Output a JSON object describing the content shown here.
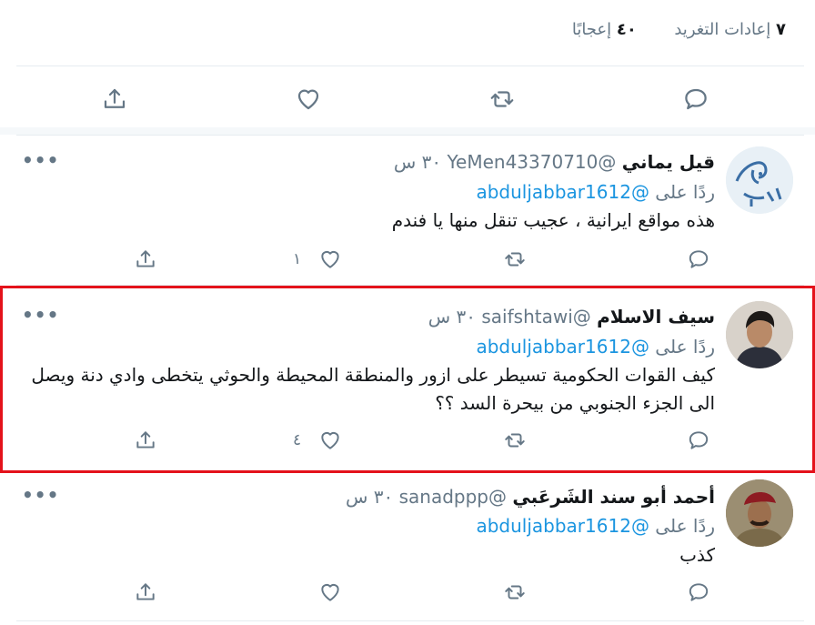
{
  "stats": {
    "retweets_count": "٧",
    "retweets_label": "إعادات التغريد",
    "likes_count": "٤٠",
    "likes_label": "إعجابًا"
  },
  "main_actions": {
    "reply_icon": "reply-icon",
    "retweet_icon": "retweet-icon",
    "like_icon": "heart-icon",
    "share_icon": "share-icon"
  },
  "replies": [
    {
      "name": "قيل يماني",
      "handle": "@YeMen43370710",
      "time": "٣٠ س",
      "replying_prefix": "ردًا على",
      "replying_to": "@abduljabbar1612",
      "text": "هذه مواقع ايرانية ، عجيب تنقل منها يا فندم",
      "like_count": "١",
      "more": "•••"
    },
    {
      "name": "سيف الاسلام",
      "handle": "@saifshtawi",
      "time": "٣٠ س",
      "replying_prefix": "ردًا على",
      "replying_to": "@abduljabbar1612",
      "text": "كيف القوات الحكومية تسيطر على ازور والمنطقة المحيطة والحوثي يتخطى وادي دنة ويصل الى الجزء الجنوبي من بيحرة السد ؟؟",
      "like_count": "٤",
      "more": "•••"
    },
    {
      "name": "أحمد أبو سند الشَرعَبي",
      "handle": "@sanadppp",
      "time": "٣٠ س",
      "replying_prefix": "ردًا على",
      "replying_to": "@abduljabbar1612",
      "text": "كذب",
      "like_count": "",
      "more": "•••"
    }
  ],
  "colors": {
    "link": "#1b95e0",
    "muted": "#657786",
    "highlight": "#e4121b"
  }
}
